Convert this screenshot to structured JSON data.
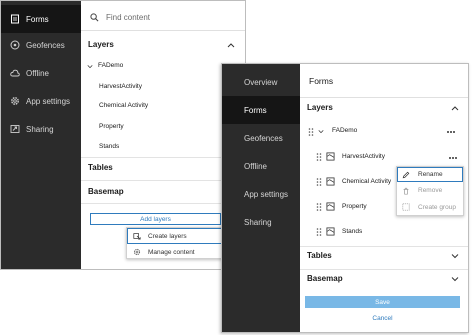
{
  "panel1": {
    "nav": [
      {
        "label": "Forms",
        "icon": "forms-icon"
      },
      {
        "label": "Geofences",
        "icon": "geofence-icon"
      },
      {
        "label": "Offline",
        "icon": "cloud-icon"
      },
      {
        "label": "App settings",
        "icon": "gear-icon"
      },
      {
        "label": "Sharing",
        "icon": "share-icon"
      }
    ],
    "search_placeholder": "Find content",
    "layers_title": "Layers",
    "map_name": "FADemo",
    "layers": [
      "HarvestActivity",
      "Chemical Activity",
      "Property",
      "Stands"
    ],
    "tables_title": "Tables",
    "basemap_title": "Basemap",
    "add_layers_label": "Add layers",
    "add_menu": [
      "Create layers",
      "Manage content"
    ]
  },
  "panel2": {
    "nav": [
      {
        "label": "Overview"
      },
      {
        "label": "Forms"
      },
      {
        "label": "Geofences"
      },
      {
        "label": "Offline"
      },
      {
        "label": "App settings"
      },
      {
        "label": "Sharing"
      }
    ],
    "header": "Forms",
    "layers_title": "Layers",
    "map_name": "FADemo",
    "layers": [
      "HarvestActivity",
      "Chemical Activity",
      "Property",
      "Stands"
    ],
    "context_menu": [
      "Rename",
      "Remove",
      "Create group"
    ],
    "tables_title": "Tables",
    "basemap_title": "Basemap",
    "save_label": "Save",
    "cancel_label": "Cancel"
  },
  "colors": {
    "accent": "#2f7bbd",
    "dark_nav": "#2b2b2b",
    "active_nav": "#151515",
    "save_disabled": "#79b8e6"
  }
}
